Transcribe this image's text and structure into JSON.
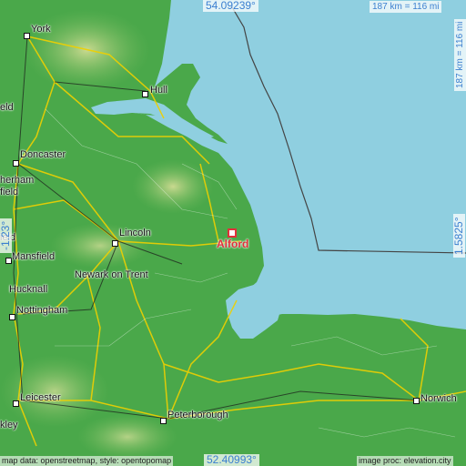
{
  "map": {
    "places": [
      {
        "name": "York"
      },
      {
        "name": "Hull"
      },
      {
        "name": "eld"
      },
      {
        "name": "Doncaster"
      },
      {
        "name": "herham"
      },
      {
        "name": "field"
      },
      {
        "name": "Lincoln"
      },
      {
        "name": "Mansfield"
      },
      {
        "name": "Newark on Trent"
      },
      {
        "name": "Hucknall"
      },
      {
        "name": "Nottingham"
      },
      {
        "name": "Leicester"
      },
      {
        "name": "kley"
      },
      {
        "name": "Peterborough"
      },
      {
        "name": "Norwich"
      },
      {
        "name": "ield"
      }
    ],
    "target": {
      "name": "Alford"
    },
    "coords": {
      "top": "54.09239°",
      "bottom": "52.40993°",
      "left": "-1.23°",
      "right": "1.5825°"
    },
    "scale": {
      "top": "187 km = 116 mi",
      "right": "187 km = 116 mi"
    },
    "credits": {
      "left": "map data: openstreetmap, style: opentopomap",
      "right": "image proc: elevation.city"
    },
    "colors": {
      "sea": "#8fcfe0",
      "land": "#4aa84a",
      "highland": "#9ccb7a",
      "road": "#f0d000",
      "target": "#e0303a"
    }
  }
}
